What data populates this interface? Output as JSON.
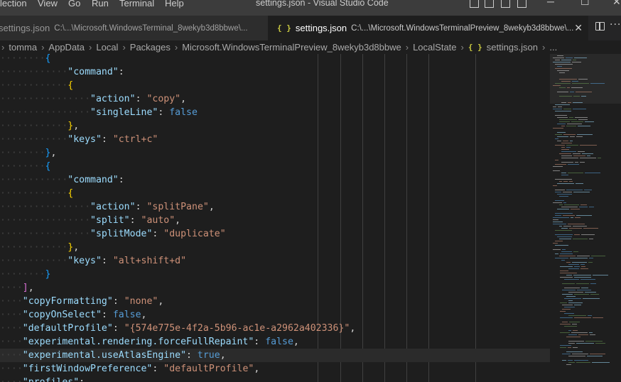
{
  "titlebar": {
    "menu": [
      "lection",
      "View",
      "Go",
      "Run",
      "Terminal",
      "Help"
    ],
    "window_title": "settings.json - Visual Studio Code",
    "minimize": "─",
    "maximize": "☐",
    "close": "✕"
  },
  "tabs": [
    {
      "name": "settings.json",
      "path": "C:\\...\\Microsoft.WindowsTerminal_8wekyb3d8bbwe\\...",
      "active": false
    },
    {
      "name": "settings.json",
      "path": "C:\\...\\Microsoft.WindowsTerminalPreview_8wekyb3d8bbwe\\...",
      "active": true,
      "icon": "{ }",
      "close": "✕"
    }
  ],
  "tab_actions": {
    "more": "···"
  },
  "breadcrumb": {
    "items": [
      "tomma",
      "AppData",
      "Local",
      "Packages",
      "Microsoft.WindowsTerminalPreview_8wekyb3d8bbwe",
      "LocalState",
      "settings.json",
      "..."
    ],
    "json_icon": "{ }"
  },
  "colors": {
    "background": "#1e1e1e",
    "key": "#9cdcfe",
    "string": "#ce9178",
    "boolean": "#569cd6",
    "bracket_gold": "#ffd700",
    "bracket_purple": "#da70d6",
    "bracket_blue": "#179fff"
  },
  "code_lines": [
    "        {",
    "            \"command\":",
    "            {",
    "                \"action\": \"copy\",",
    "                \"singleLine\": false",
    "            },",
    "            \"keys\": \"ctrl+c\"",
    "        },",
    "        {",
    "            \"command\":",
    "            {",
    "                \"action\": \"splitPane\",",
    "                \"split\": \"auto\",",
    "                \"splitMode\": \"duplicate\"",
    "            },",
    "            \"keys\": \"alt+shift+d\"",
    "        }",
    "    ],",
    "    \"copyFormatting\": \"none\",",
    "    \"copyOnSelect\": false,",
    "    \"defaultProfile\": \"{574e775e-4f2a-5b96-ac1e-a2962a402336}\",",
    "    \"experimental.rendering.forceFullRepaint\": false,",
    "    \"experimental.useAtlasEngine\": true,",
    "    \"firstWindowPreference\": \"defaultProfile\",",
    "    \"profiles\":"
  ]
}
